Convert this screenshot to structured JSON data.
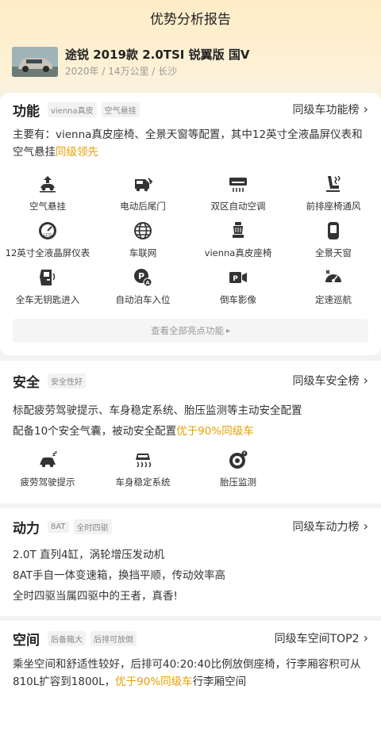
{
  "page_title": "优势分析报告",
  "car": {
    "name": "途锐 2019款 2.0TSI 锐翼版 国V",
    "meta": "2020年 / 14万公里 / 长沙"
  },
  "functions": {
    "title": "功能",
    "tags": [
      "vienna真皮",
      "空气悬挂"
    ],
    "rank_link": "同级车功能榜",
    "desc_main": "主要有：vienna真皮座椅、全景天窗等配置，其中12英寸全液晶屏仪表和空气悬挂",
    "desc_highlight": "同级领先",
    "items": [
      {
        "label": "空气悬挂",
        "icon": "air-suspension-icon"
      },
      {
        "label": "电动后尾门",
        "icon": "power-tailgate-icon"
      },
      {
        "label": "双区自动空调",
        "icon": "air-conditioner-icon"
      },
      {
        "label": "前排座椅通风",
        "icon": "seat-ventilation-icon"
      },
      {
        "label": "12英寸全液晶屏仪表",
        "icon": "lcd-gauge-icon"
      },
      {
        "label": "车联网",
        "icon": "globe-icon"
      },
      {
        "label": "vienna真皮座椅",
        "icon": "leather-seat-icon"
      },
      {
        "label": "全景天窗",
        "icon": "sunroof-icon"
      },
      {
        "label": "全车无钥匙进入",
        "icon": "keyless-entry-icon"
      },
      {
        "label": "自动泊车入位",
        "icon": "auto-parking-icon"
      },
      {
        "label": "倒车影像",
        "icon": "reverse-camera-icon"
      },
      {
        "label": "定速巡航",
        "icon": "cruise-control-icon"
      }
    ],
    "view_all": "查看全部亮点功能"
  },
  "safety": {
    "title": "安全",
    "tags": [
      "安全性好"
    ],
    "rank_link": "同级车安全榜",
    "line1": "标配疲劳驾驶提示、车身稳定系统、胎压监测等主动安全配置",
    "line2_main": "配备10个安全气囊，被动安全配置",
    "line2_highlight": "优于90%同级车",
    "items": [
      {
        "label": "疲劳驾驶提示",
        "icon": "fatigue-driving-icon"
      },
      {
        "label": "车身稳定系统",
        "icon": "stability-control-icon"
      },
      {
        "label": "胎压监测",
        "icon": "tire-pressure-icon"
      }
    ]
  },
  "power": {
    "title": "动力",
    "tags": [
      "8AT",
      "全时四驱"
    ],
    "rank_link": "同级车动力榜",
    "lines": [
      "2.0T 直列4缸，涡轮增压发动机",
      "8AT手自一体变速箱，换挡平顺，传动效率高",
      "全时四驱当属四驱中的王者，真香!"
    ]
  },
  "space": {
    "title": "空间",
    "tags": [
      "后备箱大",
      "后排可放倒"
    ],
    "rank_link": "同级车空间TOP2",
    "desc_main": "乘坐空间和舒适性较好，后排可40:20:40比例放倒座椅，行李厢容积可从810L扩容到1800L，",
    "desc_highlight": "优于90%同级车",
    "desc_tail": "行李厢空间"
  },
  "colors": {
    "highlight": "#e6a000",
    "header_bg": "#fdecc6"
  }
}
